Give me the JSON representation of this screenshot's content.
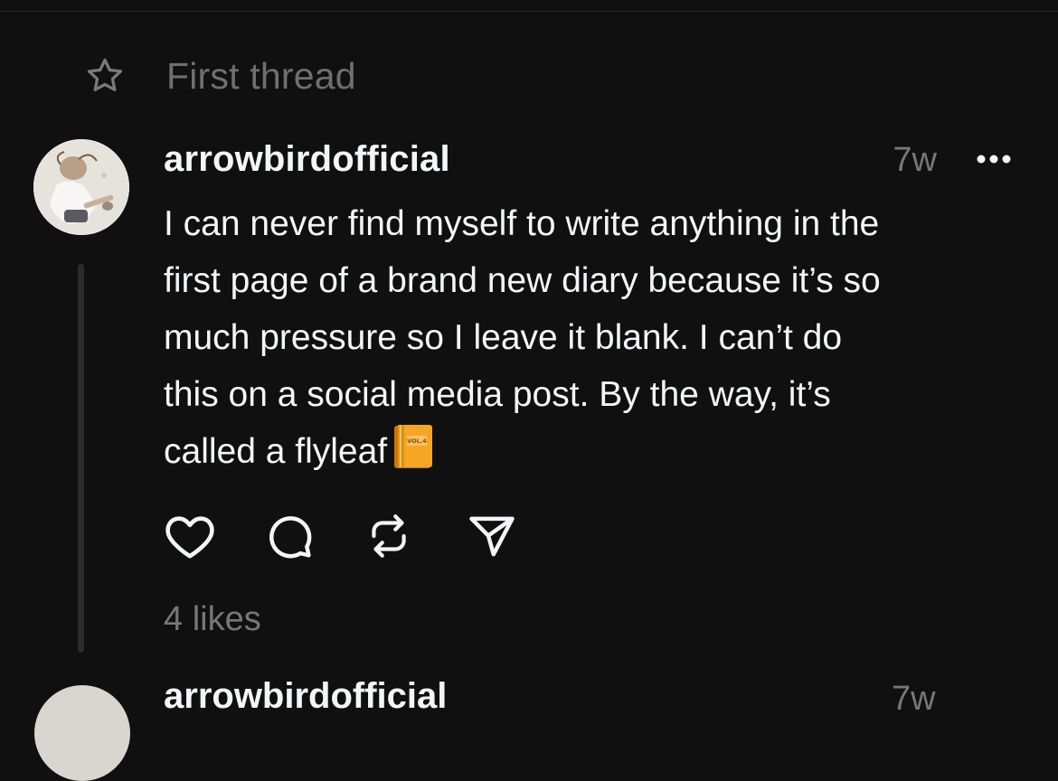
{
  "thread_header": {
    "icon": "star-icon",
    "label": "First thread"
  },
  "post": {
    "username": "arrowbirdofficial",
    "timestamp": "7w",
    "more_icon": "more-horizontal-icon",
    "text_lines": [
      "I can never find myself to write anything in the",
      "first page of a brand new diary because it’s so",
      "much pressure so I leave it blank. I can’t do",
      "this on a social media post. By the way, it’s",
      "called a flyleaf"
    ],
    "emoji": "orange-book-emoji",
    "emoji_label": "VOL.4",
    "actions": [
      {
        "name": "like",
        "icon": "heart-icon"
      },
      {
        "name": "reply",
        "icon": "comment-icon"
      },
      {
        "name": "repost",
        "icon": "repost-icon"
      },
      {
        "name": "share",
        "icon": "send-icon"
      }
    ],
    "likes": "4 likes"
  },
  "next_post": {
    "username": "arrowbirdofficial",
    "timestamp": "7w"
  },
  "colors": {
    "background": "#101010",
    "primary_text": "#f3f5f7",
    "secondary_text": "#777777",
    "thread_line": "#2c2c2c"
  }
}
